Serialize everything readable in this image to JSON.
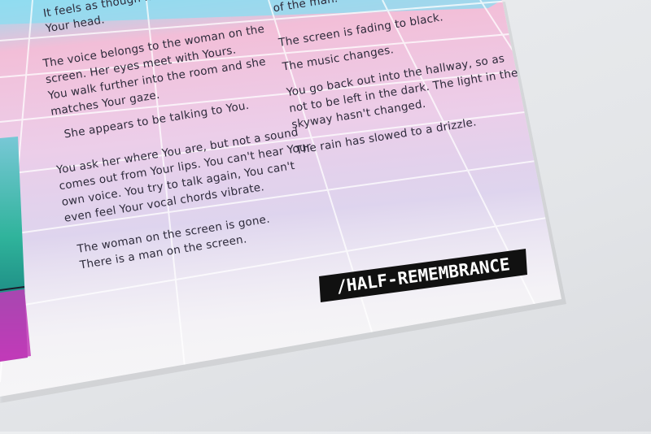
{
  "lines": [
    "It feels as though it is com",
    "Your head.",
    "of the man.",
    "The voice belongs to the woman on the",
    "screen. Her eyes meet with Yours.",
    "You walk further into the room and she",
    "matches Your gaze.",
    "She appears to be talking to You.",
    "You ask her where You are, but not a sound",
    "comes out from Your lips. You can't hear Your",
    "own voice. You try to talk again, You can't",
    "even feel Your vocal chords vibrate.",
    "The woman on the screen is gone.",
    "There is a man on the screen.",
    "The screen is fading to black.",
    "The music changes.",
    "You go back out into the hallway, so as",
    "not to be left in the dark. The light in the",
    "skyway hasn't changed.",
    "The rain has slowed to a drizzle."
  ],
  "logo": {
    "text": "/HALF-REMEMBRANCE"
  },
  "colors": {
    "background": "#e6e8eb",
    "paper": "#f6f6f7",
    "sky_pink": "#f2b8d4",
    "sky_lavender": "#cbb9e6",
    "sky_cyan": "#8fdcf0",
    "teal_band": "#2fb39b",
    "magenta_band": "#c23ab8",
    "text": "#2d2a3a",
    "logo_bg": "#111111",
    "logo_text": "#ffffff"
  }
}
